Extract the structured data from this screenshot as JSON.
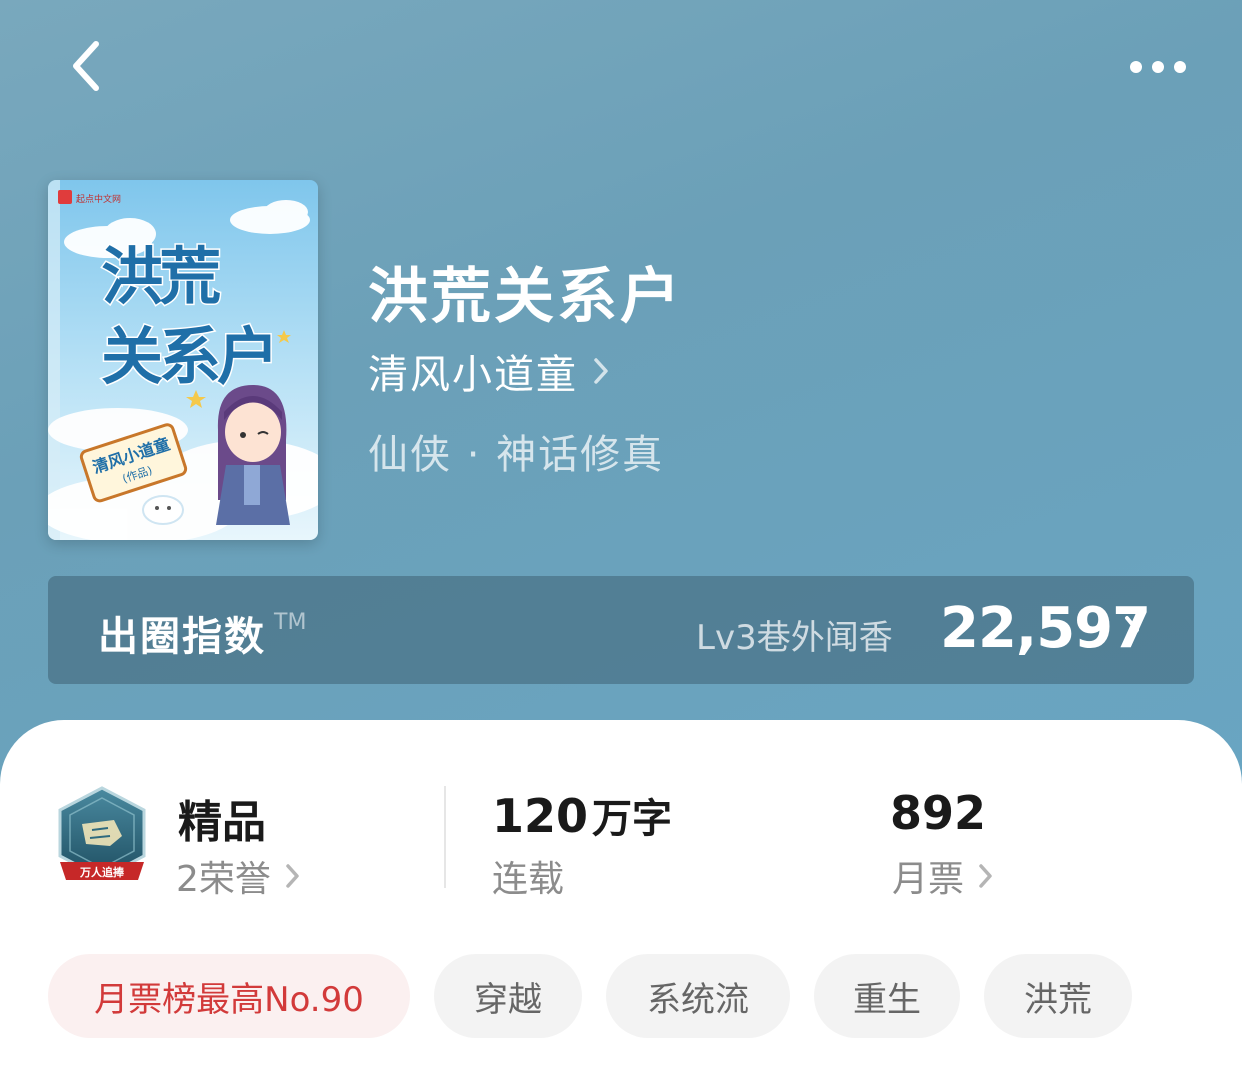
{
  "nav": {
    "back_icon": "chevron-left-icon",
    "more_icon": "more-horizontal-icon"
  },
  "book": {
    "cover_title": "洪荒关系户",
    "cover_author_stamp": "清风小道童",
    "cover_author_note": "(作品)",
    "cover_publisher": "起点中文网",
    "title": "洪荒关系户",
    "author": "清风小道童",
    "genre": "仙侠 · 神话修真"
  },
  "breakout_index": {
    "label": "出圈指数",
    "tm": "TM",
    "level": "Lv3巷外闻香",
    "score": "22,597"
  },
  "stats": {
    "quality": {
      "value": "精品",
      "label": "2荣誉",
      "badge_text": "万人追捧"
    },
    "words": {
      "number": "120",
      "unit": "万字",
      "label": "连载"
    },
    "monthly_tickets": {
      "value": "892",
      "label": "月票"
    }
  },
  "tags": [
    {
      "label": "月票榜最高No.90",
      "highlight": true
    },
    {
      "label": "穿越",
      "highlight": false
    },
    {
      "label": "系统流",
      "highlight": false
    },
    {
      "label": "重生",
      "highlight": false
    },
    {
      "label": "洪荒",
      "highlight": false
    }
  ],
  "colors": {
    "header_bg": "#6ba0b8",
    "index_card_bg": "#4f7587",
    "tag_highlight_text": "#d23a3a",
    "tag_highlight_bg": "#fbf0f0",
    "tag_text": "#666666",
    "tag_bg": "#f3f3f3"
  }
}
